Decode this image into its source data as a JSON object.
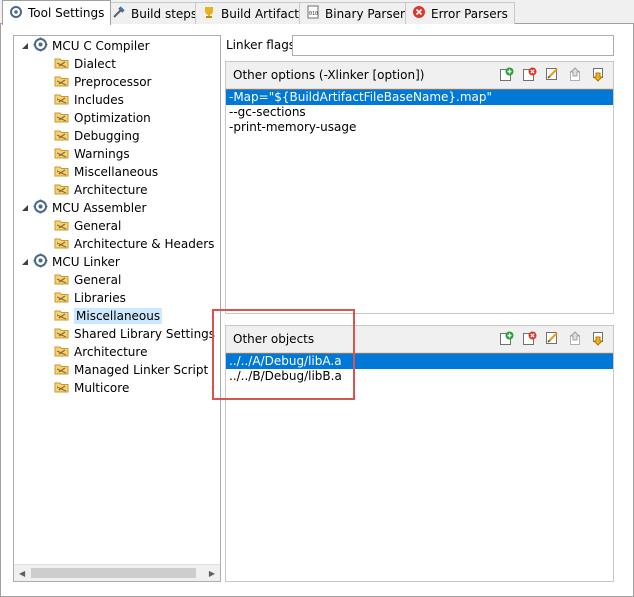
{
  "tabs": [
    {
      "label": "Tool Settings",
      "icon": "tool-settings-icon",
      "active": true
    },
    {
      "label": "Build steps",
      "icon": "build-steps-icon"
    },
    {
      "label": "Build Artifact",
      "icon": "build-artifact-icon"
    },
    {
      "label": "Binary Parsers",
      "icon": "binary-parsers-icon"
    },
    {
      "label": "Error Parsers",
      "icon": "error-parsers-icon"
    }
  ],
  "tree": {
    "nodes": [
      {
        "label": "MCU C Compiler",
        "level": 0,
        "icon": "tool-gear-icon"
      },
      {
        "label": "Dialect",
        "level": 1,
        "icon": "folder-settings-icon"
      },
      {
        "label": "Preprocessor",
        "level": 1,
        "icon": "folder-settings-icon"
      },
      {
        "label": "Includes",
        "level": 1,
        "icon": "folder-settings-icon"
      },
      {
        "label": "Optimization",
        "level": 1,
        "icon": "folder-settings-icon"
      },
      {
        "label": "Debugging",
        "level": 1,
        "icon": "folder-settings-icon"
      },
      {
        "label": "Warnings",
        "level": 1,
        "icon": "folder-settings-icon"
      },
      {
        "label": "Miscellaneous",
        "level": 1,
        "icon": "folder-settings-icon"
      },
      {
        "label": "Architecture",
        "level": 1,
        "icon": "folder-settings-icon"
      },
      {
        "label": "MCU Assembler",
        "level": 0,
        "icon": "tool-gear-icon"
      },
      {
        "label": "General",
        "level": 1,
        "icon": "folder-settings-icon"
      },
      {
        "label": "Architecture & Headers",
        "level": 1,
        "icon": "folder-settings-icon"
      },
      {
        "label": "MCU Linker",
        "level": 0,
        "icon": "tool-gear-icon"
      },
      {
        "label": "General",
        "level": 1,
        "icon": "folder-settings-icon"
      },
      {
        "label": "Libraries",
        "level": 1,
        "icon": "folder-settings-icon"
      },
      {
        "label": "Miscellaneous",
        "level": 1,
        "icon": "folder-settings-icon",
        "selected": true
      },
      {
        "label": "Shared Library Settings",
        "level": 1,
        "icon": "folder-settings-icon"
      },
      {
        "label": "Architecture",
        "level": 1,
        "icon": "folder-settings-icon"
      },
      {
        "label": "Managed Linker Script",
        "level": 1,
        "icon": "folder-settings-icon"
      },
      {
        "label": "Multicore",
        "level": 1,
        "icon": "folder-settings-icon"
      }
    ]
  },
  "linker_flags": {
    "label": "Linker flags",
    "value": ""
  },
  "other_options": {
    "title": "Other options (-Xlinker [option])",
    "items": [
      "-Map=\"${BuildArtifactFileBaseName}.map\"",
      "--gc-sections",
      "-print-memory-usage"
    ],
    "selected_index": 0
  },
  "other_objects": {
    "title": "Other objects",
    "items": [
      "../../A/Debug/libA.a",
      "../../B/Debug/libB.a"
    ],
    "selected_index": 0
  },
  "toolbar_icons": [
    "add-icon",
    "delete-icon",
    "edit-icon",
    "move-up-icon",
    "move-down-icon"
  ],
  "colors": {
    "selection": "#0078d7",
    "tree_selection": "#cce8ff",
    "highlight_box": "#d9534f"
  }
}
